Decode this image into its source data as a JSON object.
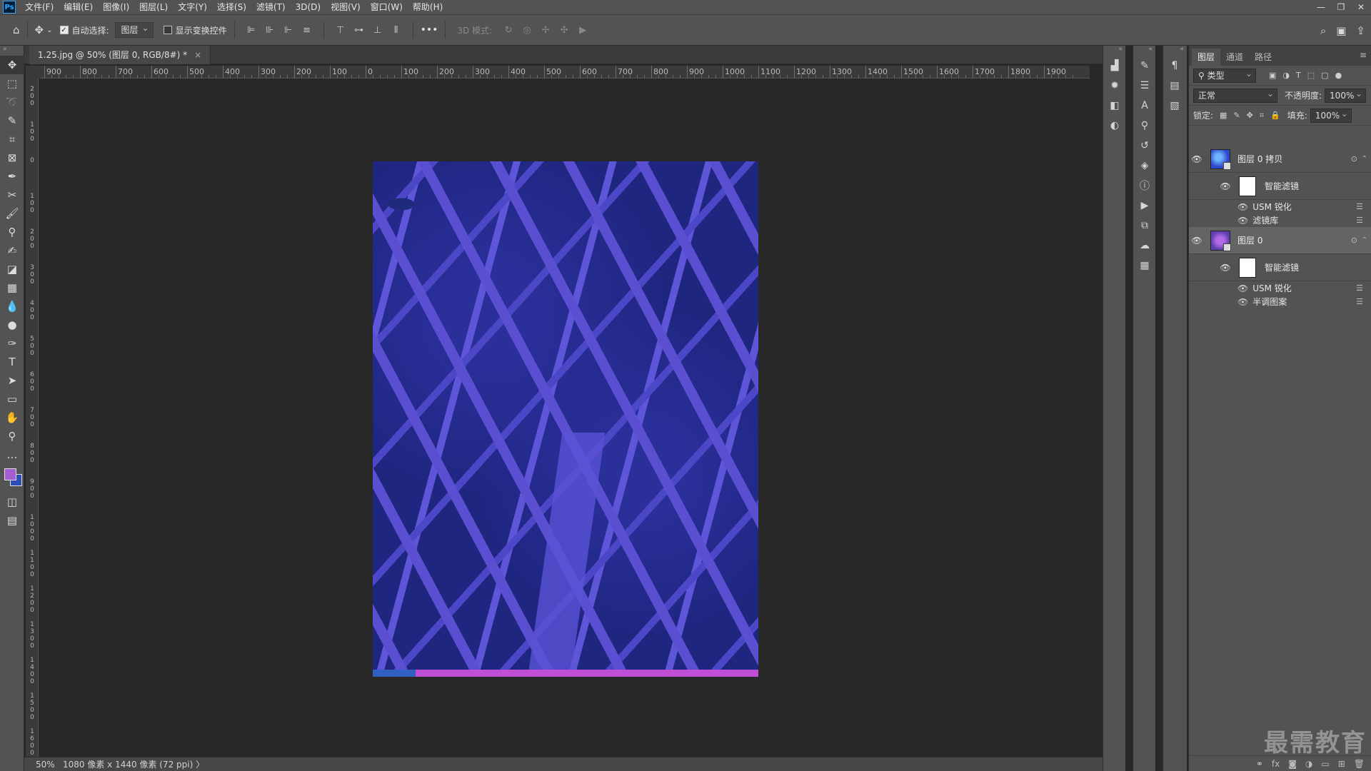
{
  "menubar": {
    "logo": "Ps",
    "items": [
      "文件(F)",
      "编辑(E)",
      "图像(I)",
      "图层(L)",
      "文字(Y)",
      "选择(S)",
      "滤镜(T)",
      "3D(D)",
      "视图(V)",
      "窗口(W)",
      "帮助(H)"
    ],
    "win": {
      "min": "—",
      "restore": "❐",
      "close": "✕"
    }
  },
  "options": {
    "auto_select_label": "自动选择:",
    "auto_select_value": "图层",
    "transform_label": "显示变换控件",
    "mode3d_label": "3D 模式:",
    "more": "•••"
  },
  "document": {
    "tab_title": "1.25.jpg @ 50% (图层 0, RGB/8#) *",
    "close": "×"
  },
  "ruler_h": [
    "900",
    "800",
    "700",
    "600",
    "500",
    "400",
    "300",
    "200",
    "100",
    "0",
    "100",
    "200",
    "300",
    "400",
    "500",
    "600",
    "700",
    "800",
    "900",
    "1000",
    "1100",
    "1200",
    "1300",
    "1400",
    "1500",
    "1600",
    "1700",
    "1800",
    "1900"
  ],
  "ruler_v": [
    "2 0 0",
    "1 0 0",
    "0",
    "1 0 0",
    "2 0 0",
    "3 0 0",
    "4 0 0",
    "5 0 0",
    "6 0 0",
    "7 0 0",
    "8 0 0",
    "9 0 0",
    "1 0 0 0",
    "1 1 0 0",
    "1 2 0 0",
    "1 3 0 0",
    "1 4 0 0",
    "1 5 0 0",
    "1 6 0 0"
  ],
  "status": {
    "zoom": "50%",
    "dims": "1080 像素 x 1440 像素 (72 ppi)",
    "arrow": "〉"
  },
  "layers_panel": {
    "tabs": [
      "图层",
      "通道",
      "路径"
    ],
    "filter_kind": "类型",
    "blend_mode": "正常",
    "opacity_label": "不透明度:",
    "opacity_value": "100%",
    "lock_label": "锁定:",
    "fill_label": "填充:",
    "fill_value": "100%",
    "layers": [
      {
        "name": "图层 0 拷贝",
        "smart_filter": "智能滤镜",
        "filters": [
          "USM 锐化",
          "滤镜库"
        ]
      },
      {
        "name": "图层 0",
        "smart_filter": "智能滤镜",
        "filters": [
          "USM 锐化",
          "半调图案"
        ]
      }
    ]
  },
  "watermark": "最需教育",
  "colors": {
    "foreground": "#a45ed0",
    "background": "#2d4fb5",
    "panel": "#535353",
    "canvas": "#282828"
  }
}
